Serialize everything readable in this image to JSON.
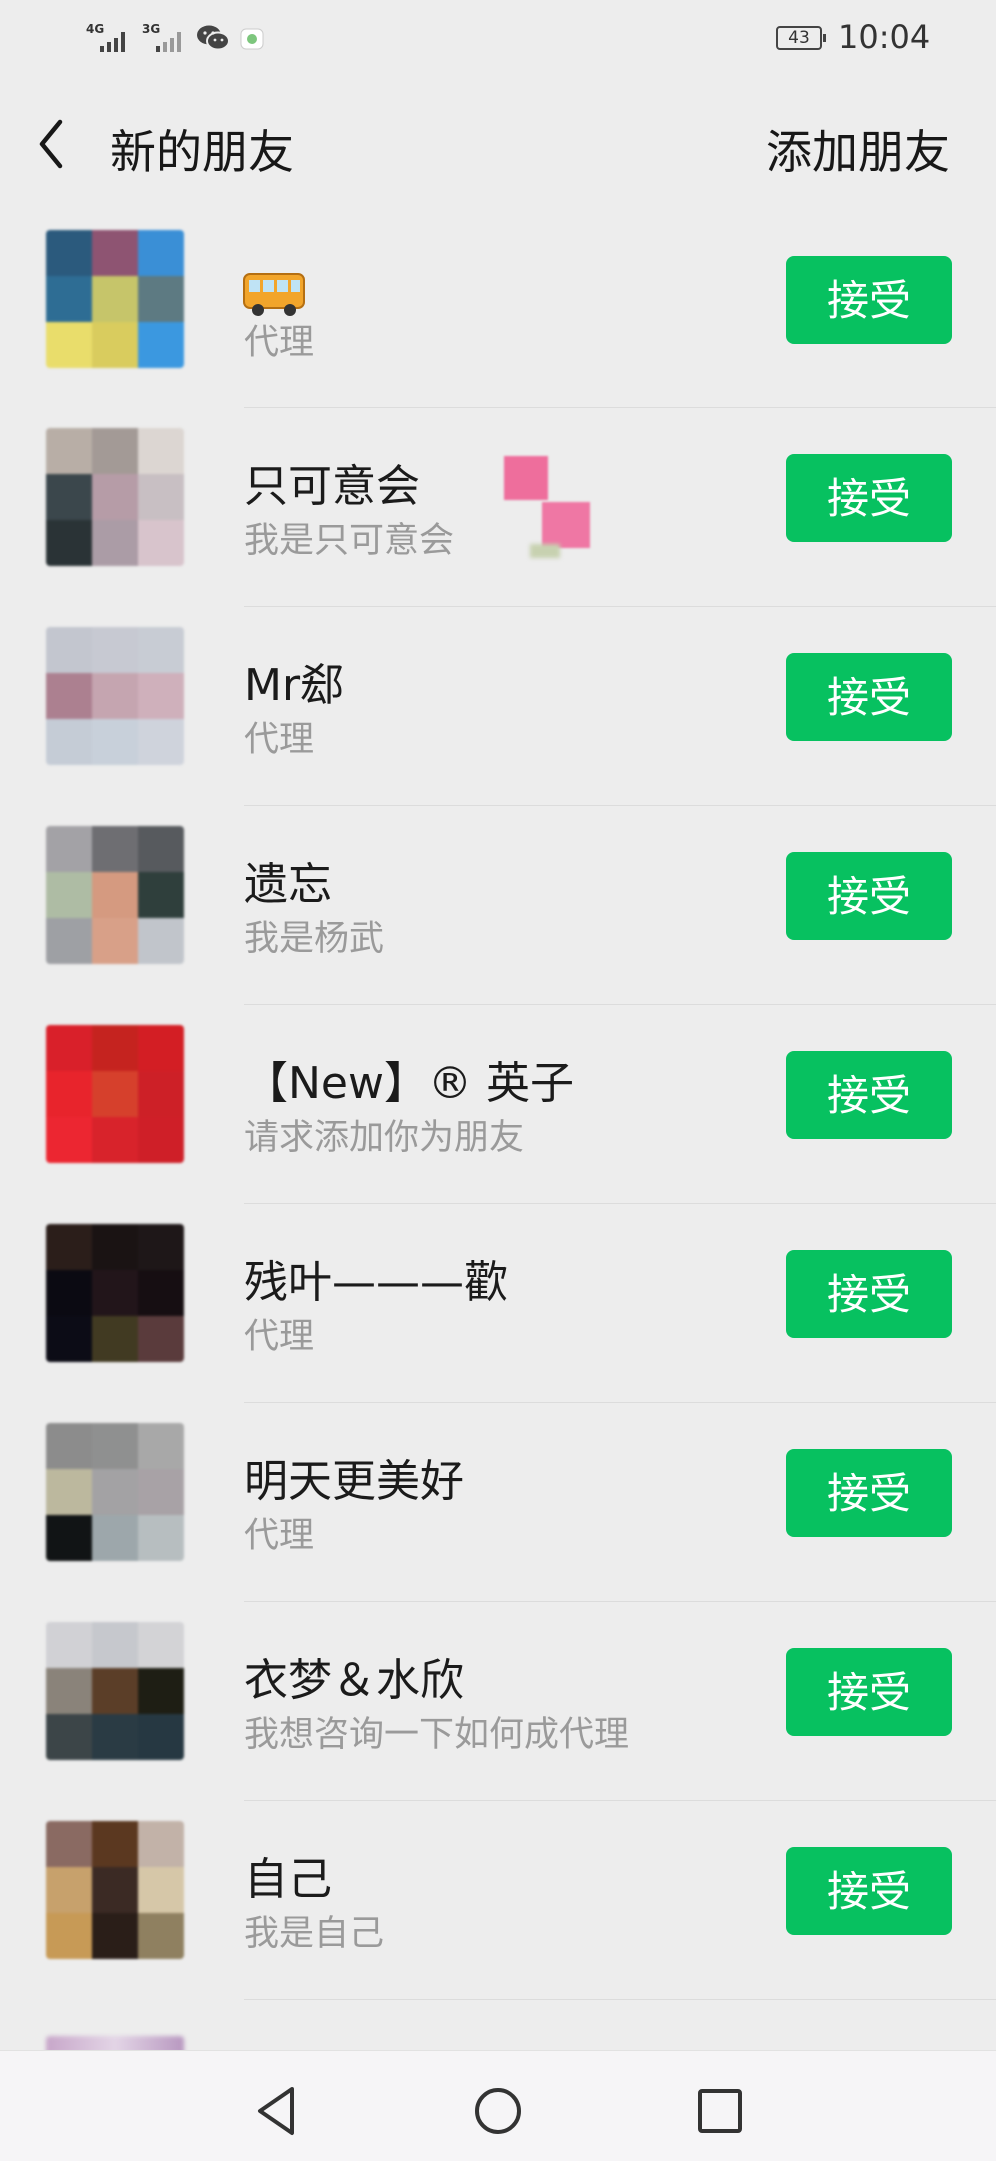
{
  "status_bar": {
    "signal_1_label": "4G",
    "signal_2_label": "3G",
    "battery": "43",
    "time": "10:04"
  },
  "header": {
    "title": "新的朋友",
    "add_friend": "添加朋友"
  },
  "accept_label": "接受",
  "requests": [
    {
      "name": "",
      "name_icon": "bus-emoji",
      "subtitle": "代理",
      "avatar": [
        "#2b5a7d",
        "#8e5472",
        "#3a8fd6",
        "#2e6d94",
        "#c6c56a",
        "#5d7a82",
        "#e9dd6b",
        "#d9cc5e",
        "#3b98e0"
      ]
    },
    {
      "name": "只可意会",
      "subtitle": "我是只可意会",
      "avatar": [
        "#b8aea6",
        "#a39a96",
        "#dcd6d2",
        "#3b474c",
        "#b69ca7",
        "#c8bfc3",
        "#2a3336",
        "#ab9ca6",
        "#d8c4cc"
      ]
    },
    {
      "name": "Mr郄",
      "subtitle": "代理",
      "avatar": [
        "#c3c6cf",
        "#c7c9d2",
        "#c8ccd4",
        "#ac8090",
        "#c5a5b0",
        "#cfb0bb",
        "#c5ccd6",
        "#c8d0da",
        "#cfd3dc"
      ]
    },
    {
      "name": "遗忘",
      "subtitle": "我是杨武",
      "avatar": [
        "#a3a2a6",
        "#6e6e72",
        "#575a5e",
        "#aebca4",
        "#d59a80",
        "#2f3f3c",
        "#9ea0a4",
        "#d8a088",
        "#c1c5cb"
      ]
    },
    {
      "name": "【New】® 英子",
      "subtitle": "请求添加你为朋友",
      "avatar": [
        "#d9202a",
        "#c5231f",
        "#d31e24",
        "#e8242c",
        "#d6402c",
        "#cd2027",
        "#ec2631",
        "#d8232b",
        "#cf1f28"
      ]
    },
    {
      "name": "残叶———歡",
      "subtitle": "代理",
      "avatar": [
        "#2b1e1a",
        "#1a1313",
        "#1e1718",
        "#0b0a12",
        "#22151a",
        "#160e12",
        "#0c0c16",
        "#413a22",
        "#5a3b3c"
      ]
    },
    {
      "name": "明天更美好",
      "subtitle": "代理",
      "avatar": [
        "#8c8c8c",
        "#8f9090",
        "#a8a8a8",
        "#bcb89e",
        "#a3a2a4",
        "#a8a2a6",
        "#111415",
        "#9da7ab",
        "#b7bec0"
      ]
    },
    {
      "name": "衣梦＆水欣",
      "subtitle": "我想咨询一下如何成代理",
      "avatar": [
        "#d1d1d5",
        "#c6c8cd",
        "#d3d3d6",
        "#8a837a",
        "#5b3e28",
        "#1e1e14",
        "#3c4548",
        "#2a3b44",
        "#263842"
      ]
    },
    {
      "name": "自己",
      "subtitle": "我是自己",
      "avatar": [
        "#8a6a62",
        "#5b3820",
        "#c2b2a8",
        "#c7a16c",
        "#3b2a24",
        "#d6c7a8",
        "#c79a56",
        "#2a1e18",
        "#8f8060"
      ]
    }
  ],
  "nav": {
    "back": "back-triangle",
    "home": "home-circle",
    "recents": "recents-square"
  }
}
